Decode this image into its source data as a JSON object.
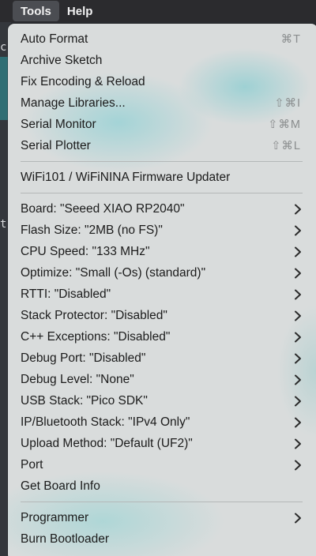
{
  "menubar": {
    "items": [
      {
        "label": "Tools",
        "active": true
      },
      {
        "label": "Help",
        "active": false
      }
    ]
  },
  "backdrop": {
    "glyph_top": "c",
    "glyph_mid": "t"
  },
  "menu": {
    "sections": [
      {
        "items": [
          {
            "label": "Auto Format",
            "shortcut": "⌘T"
          },
          {
            "label": "Archive Sketch",
            "shortcut": ""
          },
          {
            "label": "Fix Encoding & Reload",
            "shortcut": ""
          },
          {
            "label": "Manage Libraries...",
            "shortcut": "⇧⌘I"
          },
          {
            "label": "Serial Monitor",
            "shortcut": "⇧⌘M"
          },
          {
            "label": "Serial Plotter",
            "shortcut": "⇧⌘L"
          }
        ]
      },
      {
        "items": [
          {
            "label": "WiFi101 / WiFiNINA Firmware Updater",
            "shortcut": ""
          }
        ]
      },
      {
        "items": [
          {
            "label": "Board: \"Seeed XIAO RP2040\"",
            "submenu": true
          },
          {
            "label": "Flash Size: \"2MB (no FS)\"",
            "submenu": true
          },
          {
            "label": "CPU Speed: \"133 MHz\"",
            "submenu": true
          },
          {
            "label": "Optimize: \"Small (-Os) (standard)\"",
            "submenu": true
          },
          {
            "label": "RTTI: \"Disabled\"",
            "submenu": true
          },
          {
            "label": "Stack Protector: \"Disabled\"",
            "submenu": true
          },
          {
            "label": "C++ Exceptions: \"Disabled\"",
            "submenu": true
          },
          {
            "label": "Debug Port: \"Disabled\"",
            "submenu": true
          },
          {
            "label": "Debug Level: \"None\"",
            "submenu": true
          },
          {
            "label": "USB Stack: \"Pico SDK\"",
            "submenu": true
          },
          {
            "label": "IP/Bluetooth Stack: \"IPv4 Only\"",
            "submenu": true
          },
          {
            "label": "Upload Method: \"Default (UF2)\"",
            "submenu": true
          },
          {
            "label": "Port",
            "submenu": true
          },
          {
            "label": "Get Board Info",
            "submenu": false
          }
        ]
      },
      {
        "items": [
          {
            "label": "Programmer",
            "submenu": true
          },
          {
            "label": "Burn Bootloader",
            "submenu": false
          }
        ]
      }
    ]
  },
  "colors": {
    "menubar_bg": "#2b2b2e",
    "menu_bg": "#d9dcdc",
    "menu_text": "#1b1b1b",
    "shortcut_text": "#8a8d8e",
    "teal_glow": "#6ec8cd"
  }
}
